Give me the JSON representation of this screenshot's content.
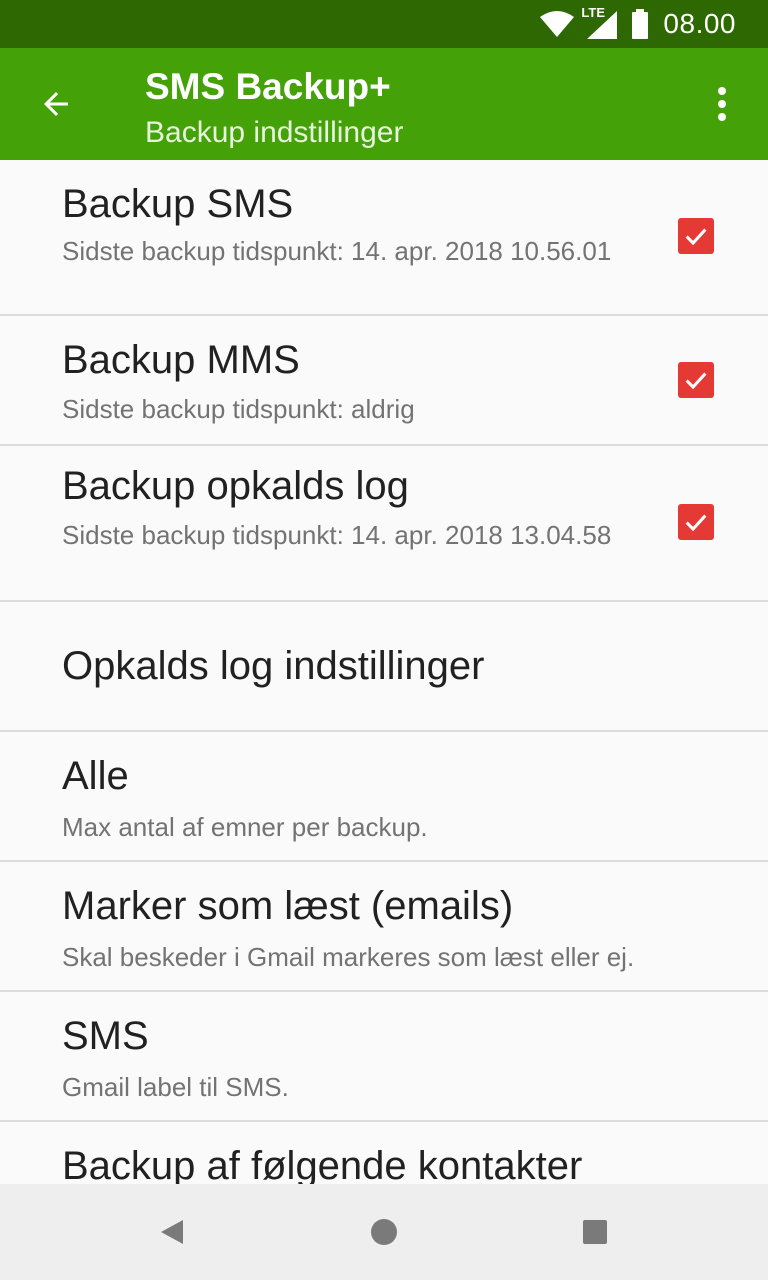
{
  "status_bar": {
    "network": "LTE",
    "time": "08.00",
    "icons": [
      "wifi-icon",
      "cell-signal-icon",
      "battery-icon"
    ]
  },
  "app_bar": {
    "title": "SMS Backup+",
    "subtitle": "Backup indstillinger",
    "back_icon": "arrow-back-icon",
    "menu_icon": "more-vert-icon"
  },
  "preferences": [
    {
      "title": "Backup SMS",
      "summary": "Sidste backup tidspunkt: 14. apr. 2018 10.56.01",
      "checked": true
    },
    {
      "title": "Backup MMS",
      "summary": "Sidste backup tidspunkt: aldrig",
      "checked": true
    },
    {
      "title": "Backup opkalds log",
      "summary": "Sidste backup tidspunkt: 14. apr. 2018 13.04.58",
      "checked": true
    },
    {
      "title": "Opkalds log indstillinger"
    },
    {
      "title": "Alle",
      "summary": "Max antal af emner per backup."
    },
    {
      "title": "Marker som læst (emails)",
      "summary": "Skal beskeder i Gmail markeres som læst eller ej."
    },
    {
      "title": "SMS",
      "summary": "Gmail label til SMS."
    },
    {
      "title": "Backup af følgende kontakter"
    }
  ],
  "colors": {
    "status_bar": "#2e6803",
    "app_bar": "#44a208",
    "checkbox": "#e53935"
  },
  "nav_bar": {
    "icons": [
      "back-triangle-icon",
      "home-circle-icon",
      "recents-square-icon"
    ]
  }
}
